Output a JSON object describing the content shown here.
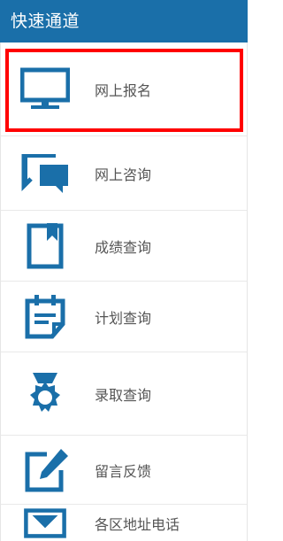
{
  "header": {
    "title": "快速通道"
  },
  "accent_color": "#1a6fa9",
  "highlight_color": "#ff0000",
  "items": [
    {
      "label": "网上报名",
      "icon": "monitor-icon",
      "selected": true
    },
    {
      "label": "网上咨询",
      "icon": "chat-bubbles-icon"
    },
    {
      "label": "成绩查询",
      "icon": "bookmark-book-icon"
    },
    {
      "label": "计划查询",
      "icon": "calendar-icon"
    },
    {
      "label": "录取查询",
      "icon": "medal-icon"
    },
    {
      "label": "留言反馈",
      "icon": "edit-note-icon"
    },
    {
      "label": "各区地址电话",
      "icon": "envelope-icon"
    }
  ]
}
